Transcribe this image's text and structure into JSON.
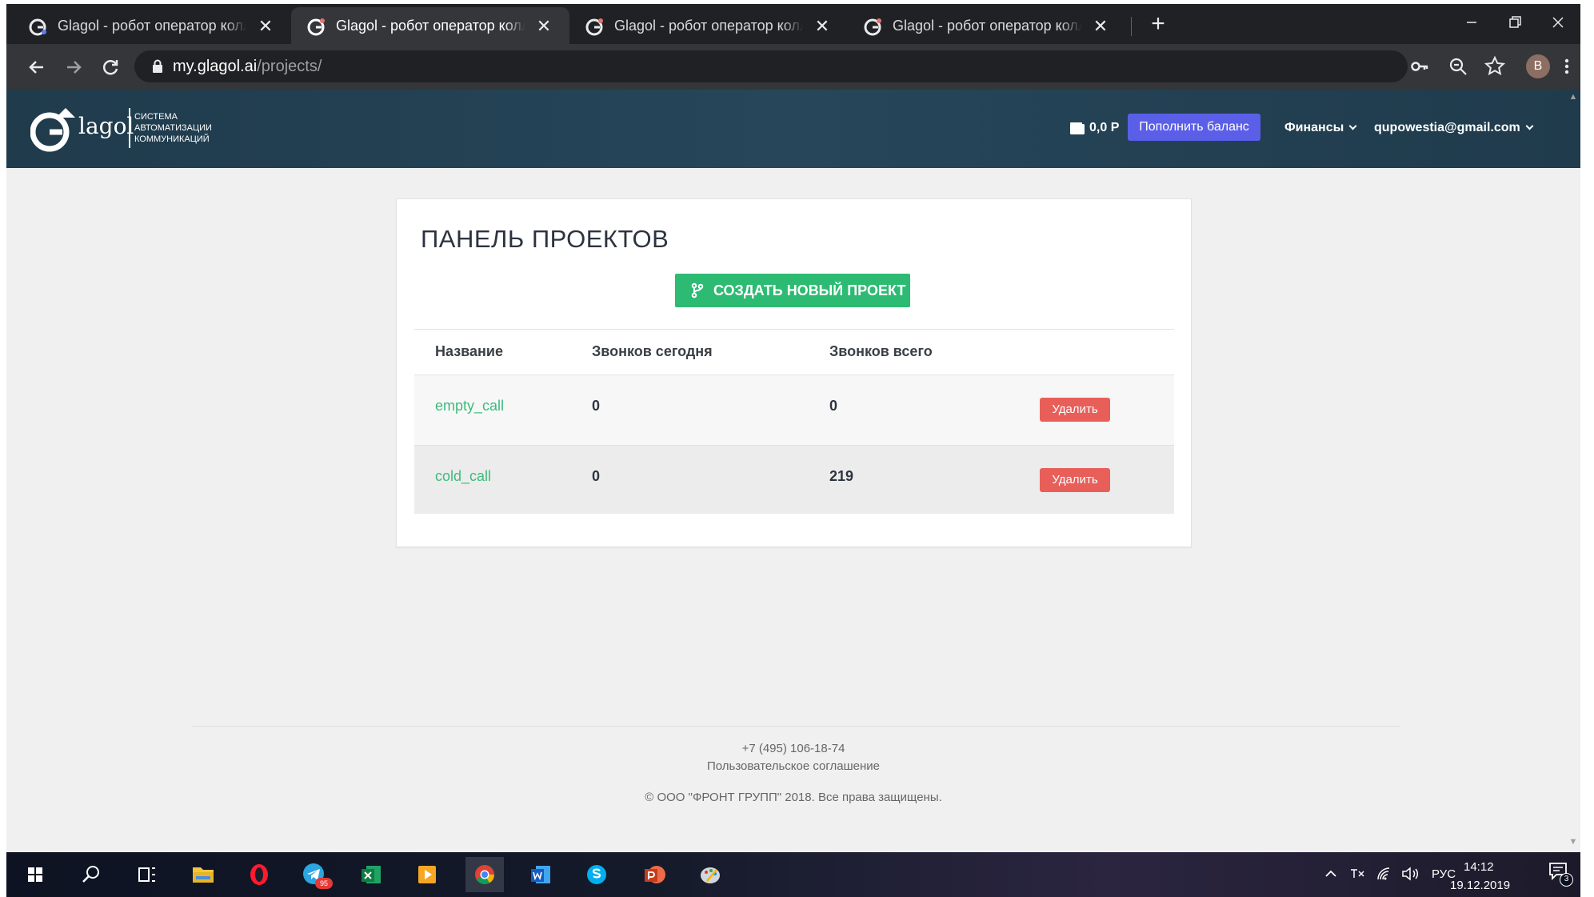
{
  "browser": {
    "tabs": [
      {
        "title": "Glagol - робот оператор колл-центра",
        "active": false
      },
      {
        "title": "Glagol - робот оператор колл-центра",
        "active": true
      },
      {
        "title": "Glagol - робот оператор колл-центра",
        "active": false
      },
      {
        "title": "Glagol - робот оператор колл-центра",
        "active": false
      }
    ],
    "close_glyph": "✕",
    "new_tab_glyph": "+",
    "url_host": "my.glagol.ai",
    "url_path": "/projects/",
    "profile_initial": "B",
    "icons": [
      "back-icon",
      "forward-icon",
      "reload-icon",
      "lock-icon",
      "key-icon",
      "zoom-icon",
      "star-icon",
      "menu-icon"
    ]
  },
  "header": {
    "logo_name": "lagol",
    "logo_tagline": [
      "СИСТЕМА",
      "АВТОМАТИЗАЦИИ",
      "КОММУНИКАЦИЙ"
    ],
    "balance": "0,0 Р",
    "topup_label": "Пополнить баланс",
    "finance_label": "Финансы",
    "user_email": "qupowestia@gmail.com",
    "accent_color": "#5b5fe8",
    "header_color": "#1f3b4c"
  },
  "panel": {
    "title": "ПАНЕЛЬ ПРОЕКТОВ",
    "create_label": "СОЗДАТЬ НОВЫЙ ПРОЕКТ",
    "create_color": "#2dbb73",
    "columns": [
      "Название",
      "Звонков сегодня",
      "Звонков всего"
    ],
    "rows": [
      {
        "name": "empty_call",
        "today": "0",
        "total": "0",
        "delete_label": "Удалить"
      },
      {
        "name": "cold_call",
        "today": "0",
        "total": "219",
        "delete_label": "Удалить"
      }
    ],
    "delete_color": "#e85f5a"
  },
  "footer": {
    "phone": "+7 (495) 106-18-74",
    "agreement": "Пользовательское соглашение",
    "copyright": "© ООО \"ФРОНТ ГРУПП\" 2018. Все права защищены."
  },
  "taskbar": {
    "apps": [
      "windows-start-icon",
      "search-icon",
      "task-view-icon",
      "file-explorer-icon",
      "opera-icon",
      "telegram-icon",
      "excel-icon",
      "media-player-icon",
      "chrome-icon",
      "word-icon",
      "skype-icon",
      "powerpoint-icon",
      "paint-icon"
    ],
    "telegram_badge": "95",
    "language": "РУС",
    "time": "14:12",
    "date": "19.12.2019",
    "notifications": "3"
  }
}
